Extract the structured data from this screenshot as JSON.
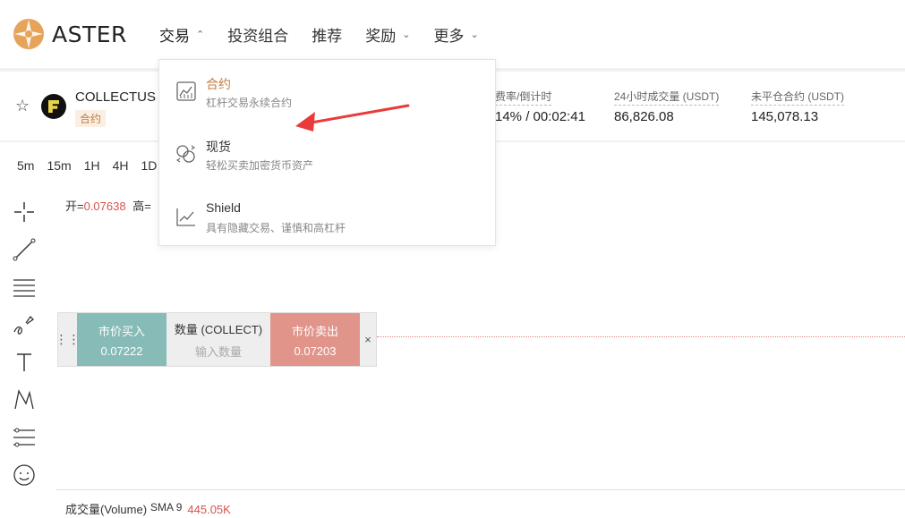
{
  "brand": {
    "name": "ASTER"
  },
  "nav": [
    {
      "label": "交易",
      "chevron": "^"
    },
    {
      "label": "投资组合",
      "chevron": ""
    },
    {
      "label": "推荐",
      "chevron": ""
    },
    {
      "label": "奖励",
      "chevron": "v"
    },
    {
      "label": "更多",
      "chevron": "v"
    }
  ],
  "pair": {
    "name": "COLLECTUS",
    "tag": "合约"
  },
  "stats": {
    "funding_label": "费率/倒计时",
    "funding_value": "14% / 00:02:41",
    "volume_label": "24小时成交量 (USDT)",
    "volume_value": "86,826.08",
    "oi_label": "未平仓合约 (USDT)",
    "oi_value": "145,078.13"
  },
  "timeframes": [
    "5m",
    "15m",
    "1H",
    "4H",
    "1D"
  ],
  "ohlc": {
    "open_label": "开=",
    "open_value": "0.07638",
    "high_label": "高="
  },
  "order": {
    "buy_label": "市价买入",
    "buy_price": "0.07222",
    "qty_label": "数量 (COLLECT)",
    "qty_placeholder": "输入数量",
    "sell_label": "市价卖出",
    "sell_price": "0.07203",
    "close": "×"
  },
  "volume": {
    "label": "成交量(Volume)",
    "sma": "SMA 9",
    "value": "445.05K"
  },
  "dropdown": [
    {
      "title": "合约",
      "sub": "杠杆交易永续合约",
      "icon": "futures-chart-icon",
      "active": true
    },
    {
      "title": "现货",
      "sub": "轻松买卖加密货币资产",
      "icon": "spot-coins-icon",
      "active": false
    },
    {
      "title": "Shield",
      "sub": "具有隐藏交易、谨慎和高杠杆",
      "icon": "shield-chart-icon",
      "active": false
    }
  ],
  "colors": {
    "accent": "#c47d3e",
    "buy": "#86bbb7",
    "sell": "#e1948a",
    "red": "#d9534f",
    "arrow": "#ea3a3a"
  }
}
